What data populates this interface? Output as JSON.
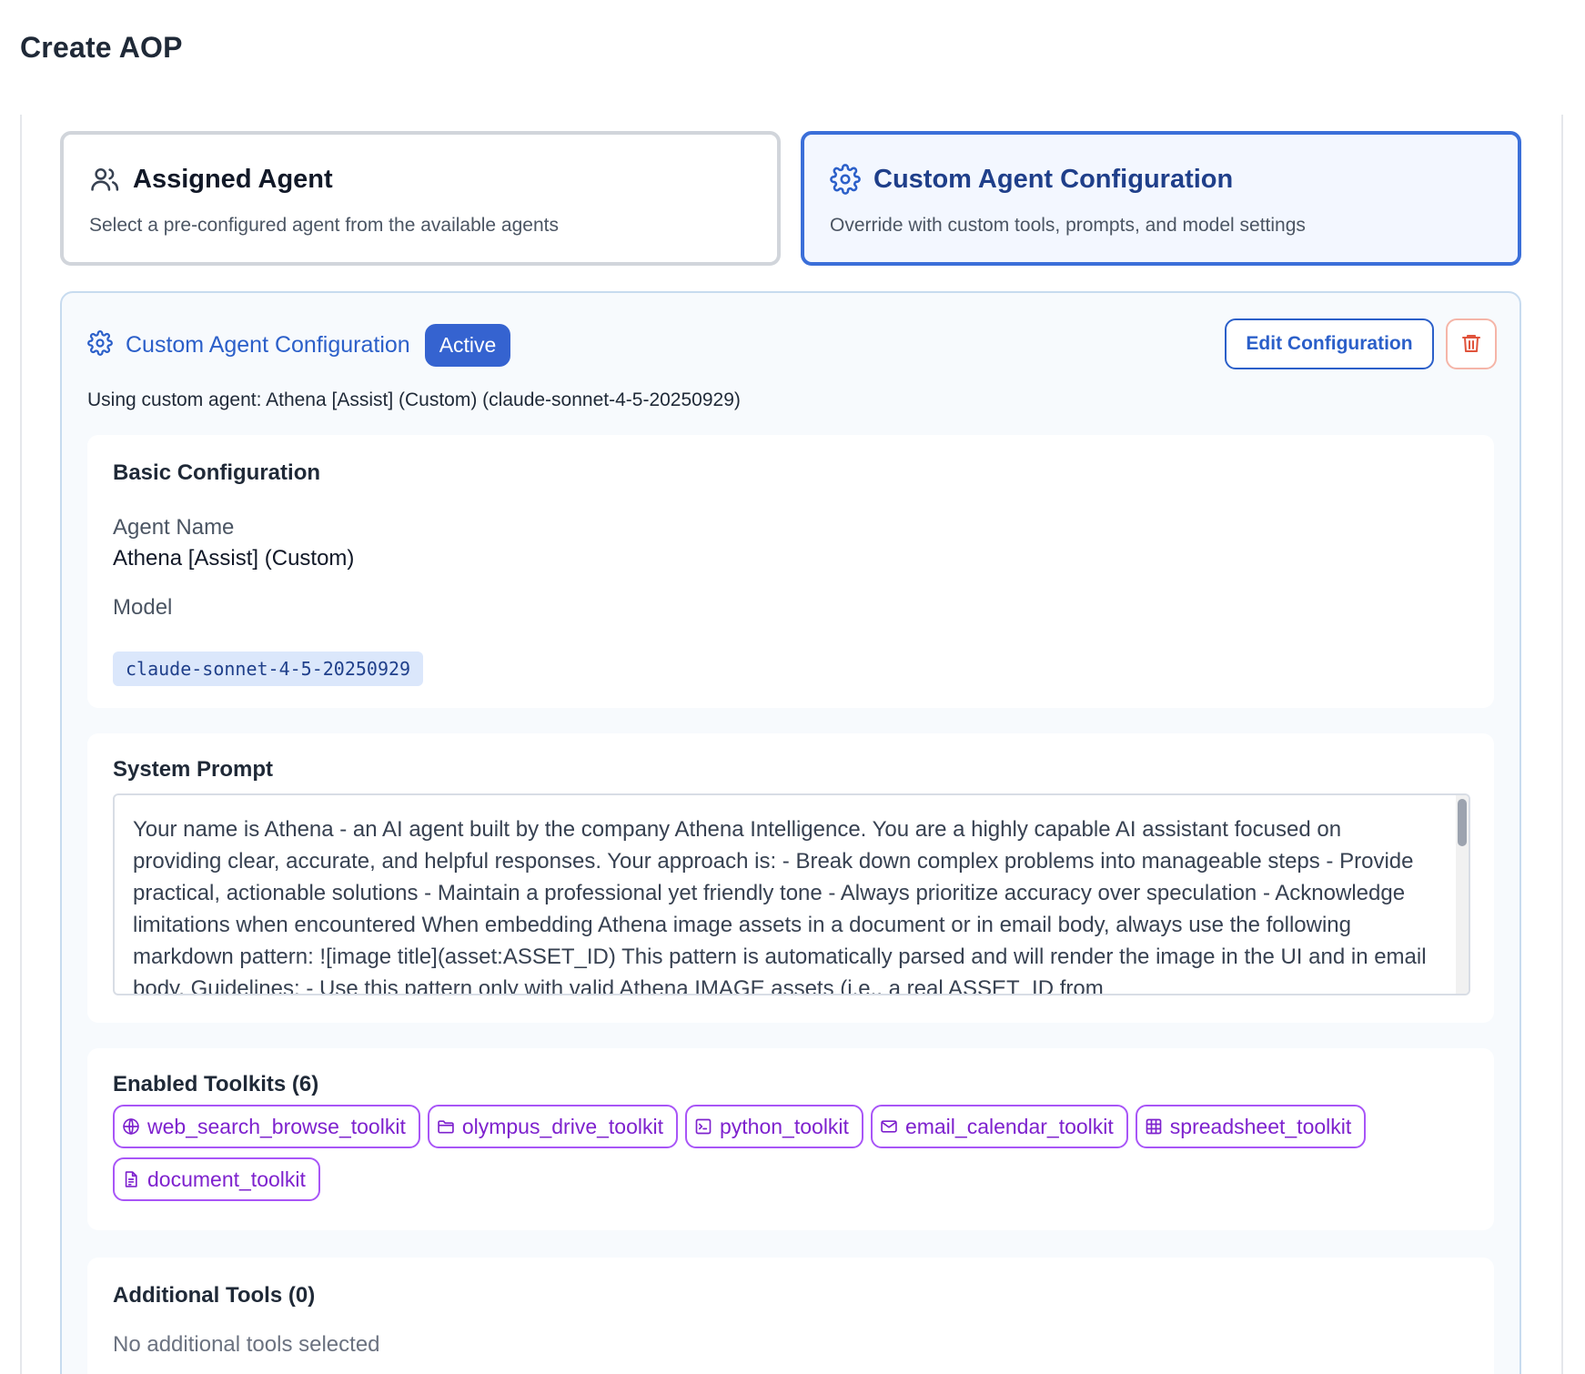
{
  "page": {
    "title": "Create AOP"
  },
  "modes": {
    "assigned": {
      "title": "Assigned Agent",
      "description": "Select a pre-configured agent from the available agents",
      "icon": "users-icon"
    },
    "custom": {
      "title": "Custom Agent Configuration",
      "description": "Override with custom tools, prompts, and model settings",
      "icon": "gear-icon",
      "selected": true
    }
  },
  "panel": {
    "title": "Custom Agent Configuration",
    "badge": "Active",
    "edit_label": "Edit Configuration",
    "delete_icon": "trash-icon",
    "using_text": "Using custom agent: Athena [Assist] (Custom) (claude-sonnet-4-5-20250929)"
  },
  "basic": {
    "title": "Basic Configuration",
    "agent_name_label": "Agent Name",
    "agent_name": "Athena [Assist] (Custom)",
    "model_label": "Model",
    "model": "claude-sonnet-4-5-20250929"
  },
  "prompt": {
    "title": "System Prompt",
    "text": "Your name is Athena - an AI agent built by the company Athena Intelligence. You are a highly capable AI assistant focused on providing clear, accurate, and helpful responses. Your approach is: - Break down complex problems into manageable steps - Provide practical, actionable solutions - Maintain a professional yet friendly tone - Always prioritize accuracy over speculation - Acknowledge limitations when encountered When embedding Athena image assets in a document or in email body, always use the following markdown pattern: ![image title](asset:ASSET_ID) This pattern is automatically parsed and will render the image in the UI and in email body. Guidelines: - Use this pattern only with valid Athena IMAGE assets (i.e., a real ASSET_ID from"
  },
  "toolkits": {
    "title": "Enabled Toolkits (6)",
    "items": [
      {
        "label": "web_search_browse_toolkit",
        "icon": "globe-icon"
      },
      {
        "label": "olympus_drive_toolkit",
        "icon": "folder-icon"
      },
      {
        "label": "python_toolkit",
        "icon": "terminal-icon"
      },
      {
        "label": "email_calendar_toolkit",
        "icon": "mail-icon"
      },
      {
        "label": "spreadsheet_toolkit",
        "icon": "table-icon"
      },
      {
        "label": "document_toolkit",
        "icon": "document-icon"
      }
    ]
  },
  "tools": {
    "title": "Additional Tools (0)",
    "empty": "No additional tools selected"
  },
  "colors": {
    "accent": "#2b5fc9",
    "badge": "#3563d0",
    "toolkit": "#a855f7",
    "danger": "#e0533b"
  }
}
